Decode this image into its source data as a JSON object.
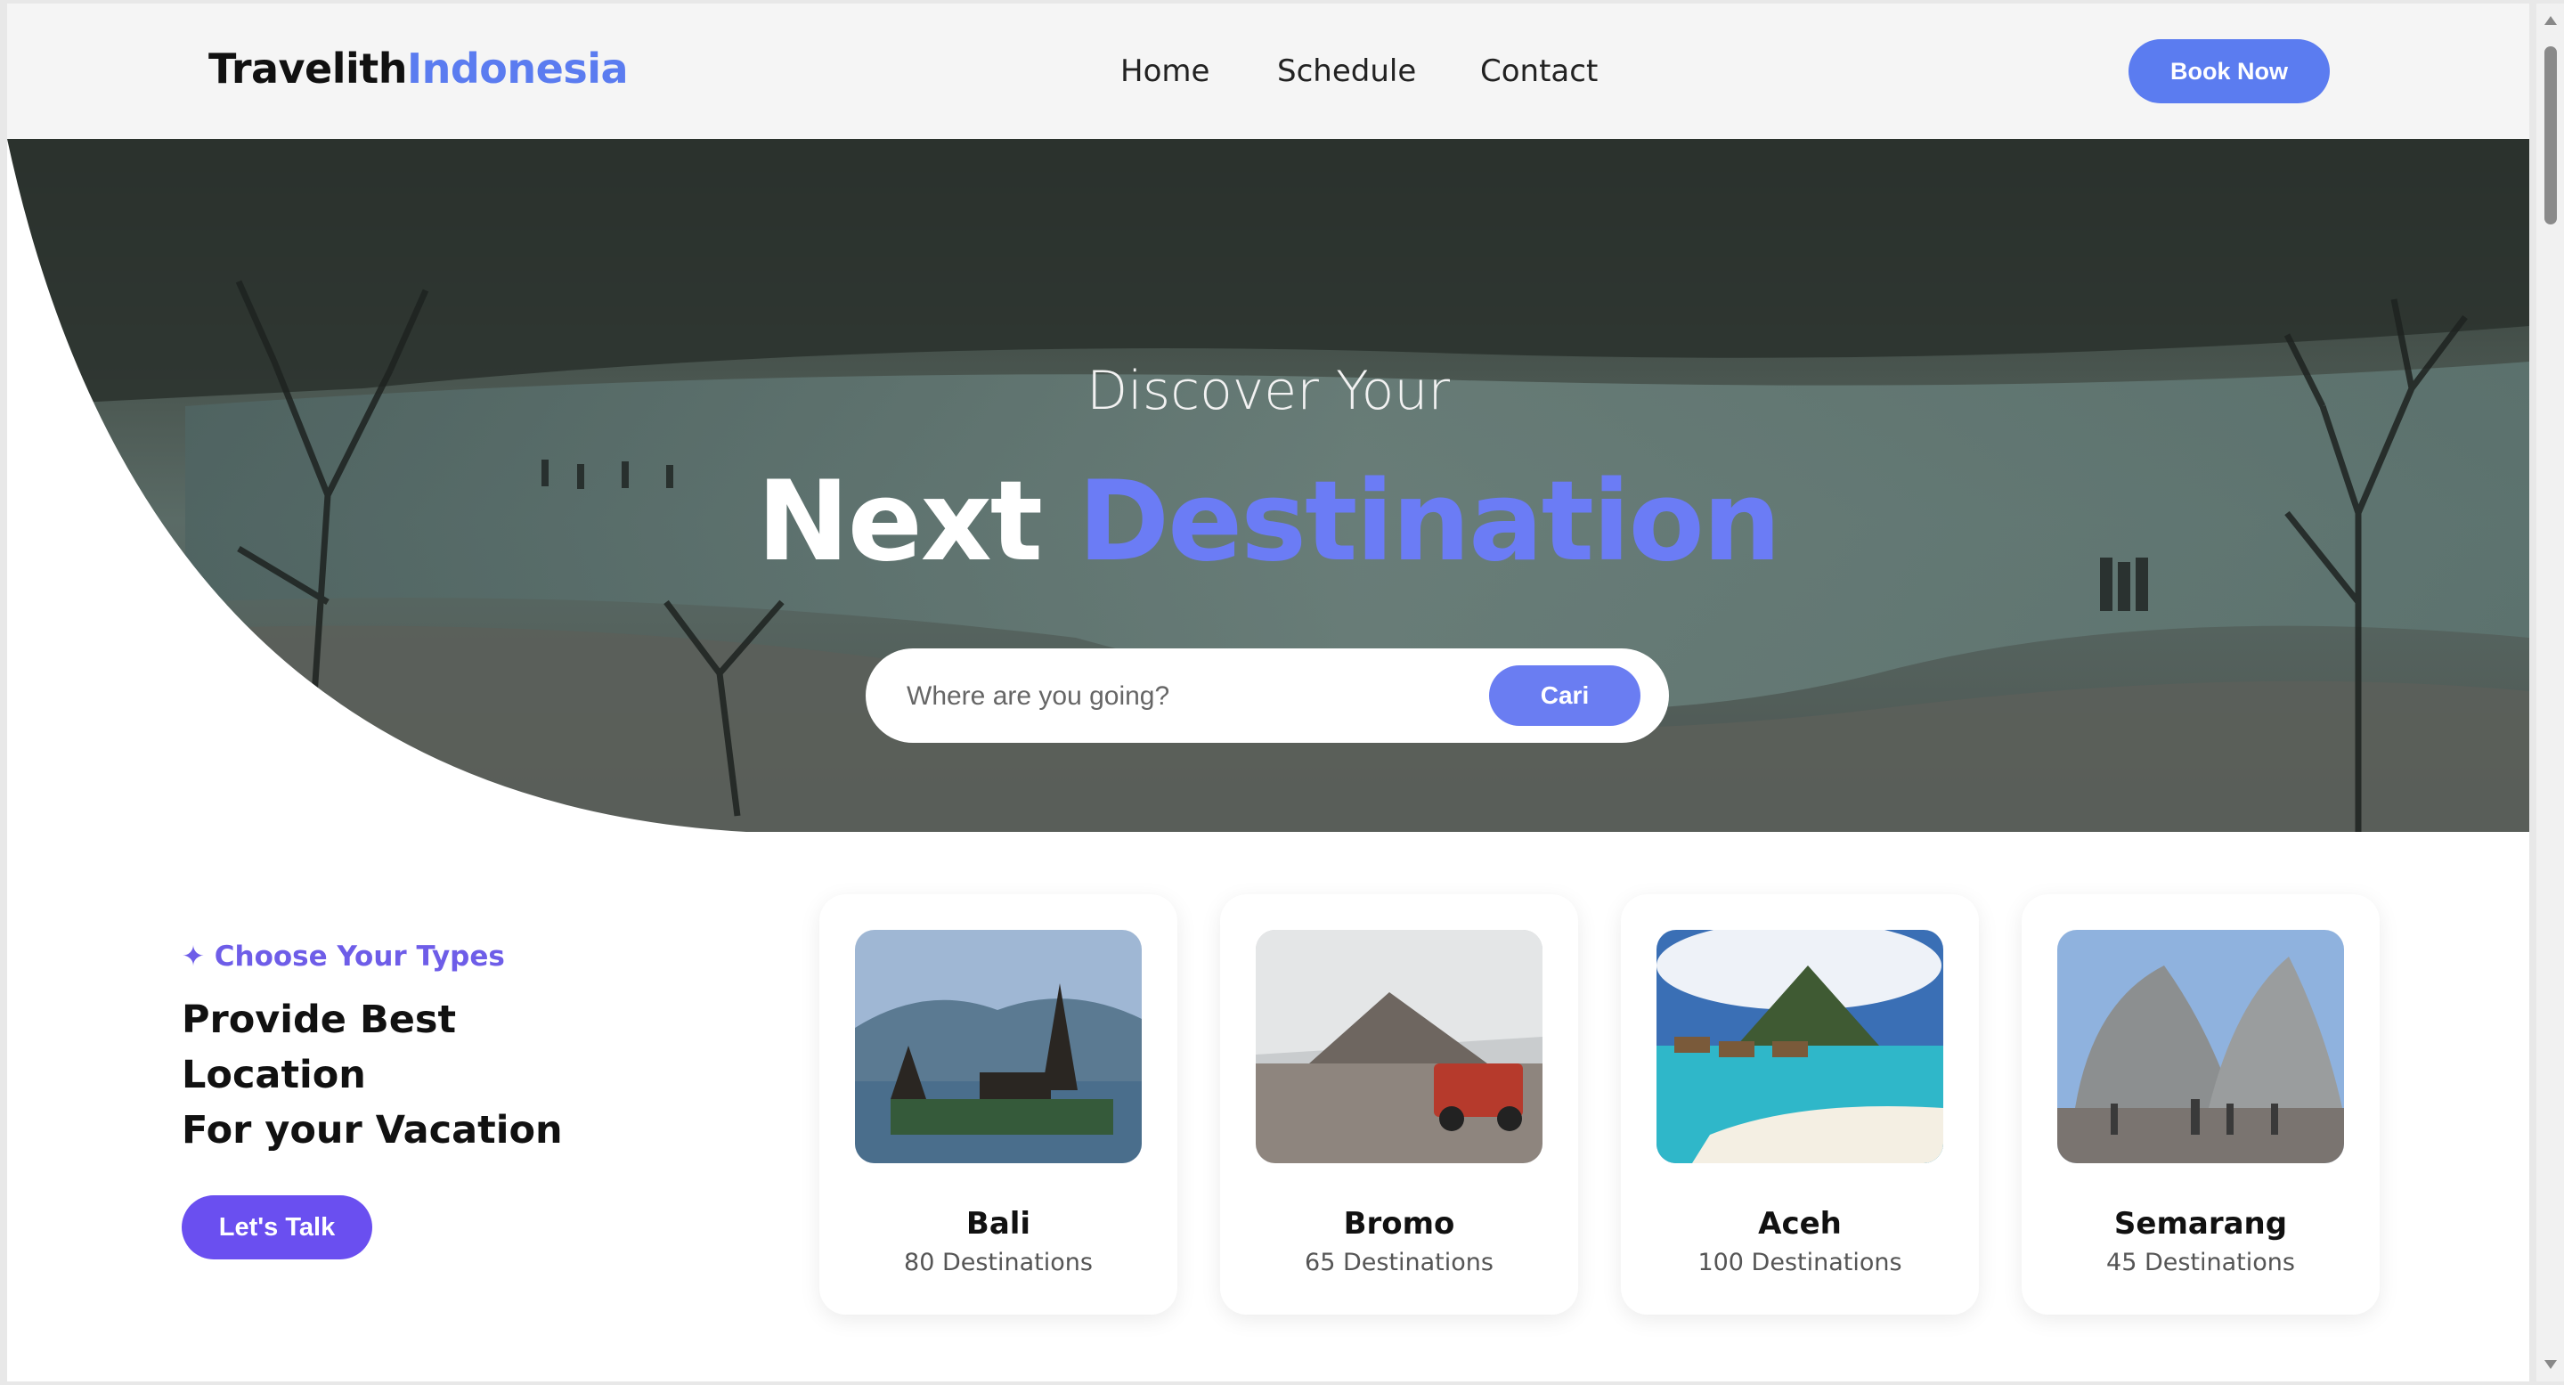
{
  "brand": {
    "name_part1": "Travelith",
    "name_part2": "Indonesia",
    "accent_color": "#5b7cf0"
  },
  "nav": {
    "links": [
      {
        "label": "Home"
      },
      {
        "label": "Schedule"
      },
      {
        "label": "Contact"
      }
    ],
    "cta_label": "Book Now"
  },
  "hero": {
    "subtitle": "Discover Your",
    "title_part1": "Next",
    "title_part2": "Destination",
    "search": {
      "placeholder": "Where are you going?",
      "button_label": "Cari"
    }
  },
  "types_section": {
    "label": "✦ Choose Your Types",
    "heading_lines": [
      "Provide Best",
      "Location",
      "For your Vacation"
    ],
    "cta_label": "Let's Talk",
    "accent_color": "#6a4ff0"
  },
  "destinations": [
    {
      "name": "Bali",
      "count": "80 Destinations",
      "image": "temple-photo"
    },
    {
      "name": "Bromo",
      "count": "65 Destinations",
      "image": "volcano-jeep-photo"
    },
    {
      "name": "Aceh",
      "count": "100 Destinations",
      "image": "overwater-bungalow-photo"
    },
    {
      "name": "Semarang",
      "count": "45 Destinations",
      "image": "dome-structure-photo"
    }
  ]
}
